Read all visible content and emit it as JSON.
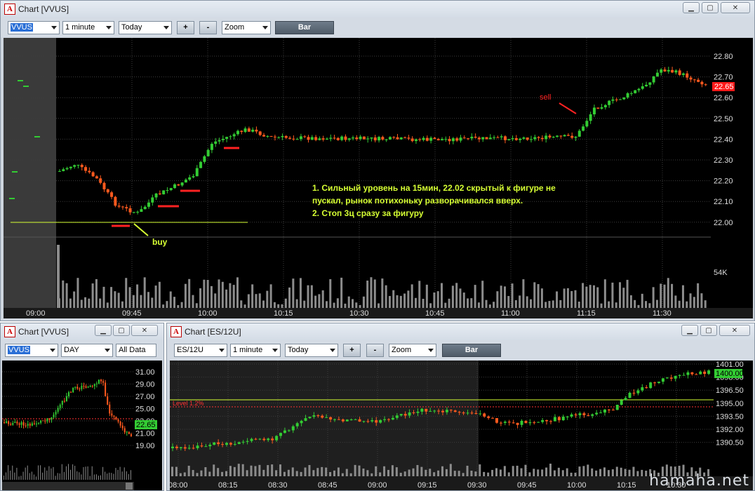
{
  "windows": {
    "main": {
      "title": "Chart [VVUS]",
      "symbol": "VVUS",
      "interval": "1 minute",
      "range": "Today",
      "plus": "+",
      "minus": "-",
      "zoom": "Zoom",
      "bar_label": "Bar",
      "price_ticks": [
        "22.80",
        "22.70",
        "22.60",
        "22.50",
        "22.40",
        "22.30",
        "22.20",
        "22.10",
        "22.00"
      ],
      "last_price": "22.65",
      "volume_tick": "54K",
      "time_ticks": [
        "09:00",
        "09:45",
        "10:00",
        "10:15",
        "10:30",
        "10:45",
        "11:00",
        "11:15",
        "11:30"
      ],
      "annotation_line1": "1. Сильный уровень на 15мин, 22.02 скрытый к фигуре не",
      "annotation_line2": "пускал, рынок потихоньку разворачивался вверх.",
      "annotation_line3": "2. Стоп 3ц сразу за фигуру",
      "buy_label": "buy",
      "sell_label": "sell"
    },
    "daily": {
      "title": "Chart [VVUS]",
      "symbol": "VVUS",
      "interval": "DAY",
      "range": "All Data",
      "price_ticks": [
        "31.00",
        "29.00",
        "27.00",
        "25.00",
        "23.00",
        "21.00",
        "19.00"
      ],
      "last_price": "22.65"
    },
    "es": {
      "title": "Chart [ES/12U]",
      "symbol": "ES/12U",
      "interval": "1 minute",
      "range": "Today",
      "plus": "+",
      "minus": "-",
      "zoom": "Zoom",
      "bar_label": "Bar",
      "price_ticks": [
        "1401.00",
        "1398.00",
        "1396.50",
        "1395.00",
        "1393.50",
        "1392.00",
        "1390.50"
      ],
      "last_price": "1400.00",
      "level_label": "Level 1.2%",
      "time_ticks": [
        "08:00",
        "08:15",
        "08:30",
        "08:45",
        "09:00",
        "09:15",
        "09:30",
        "09:45",
        "10:00",
        "10:15",
        "10:30"
      ]
    }
  },
  "colors": {
    "up": "#33cc33",
    "down": "#ff5a1e",
    "annotation": "#d6ff33",
    "marker_red": "#ff2222",
    "volume": "#8c8c8c"
  },
  "watermark": "hamaha.net"
}
